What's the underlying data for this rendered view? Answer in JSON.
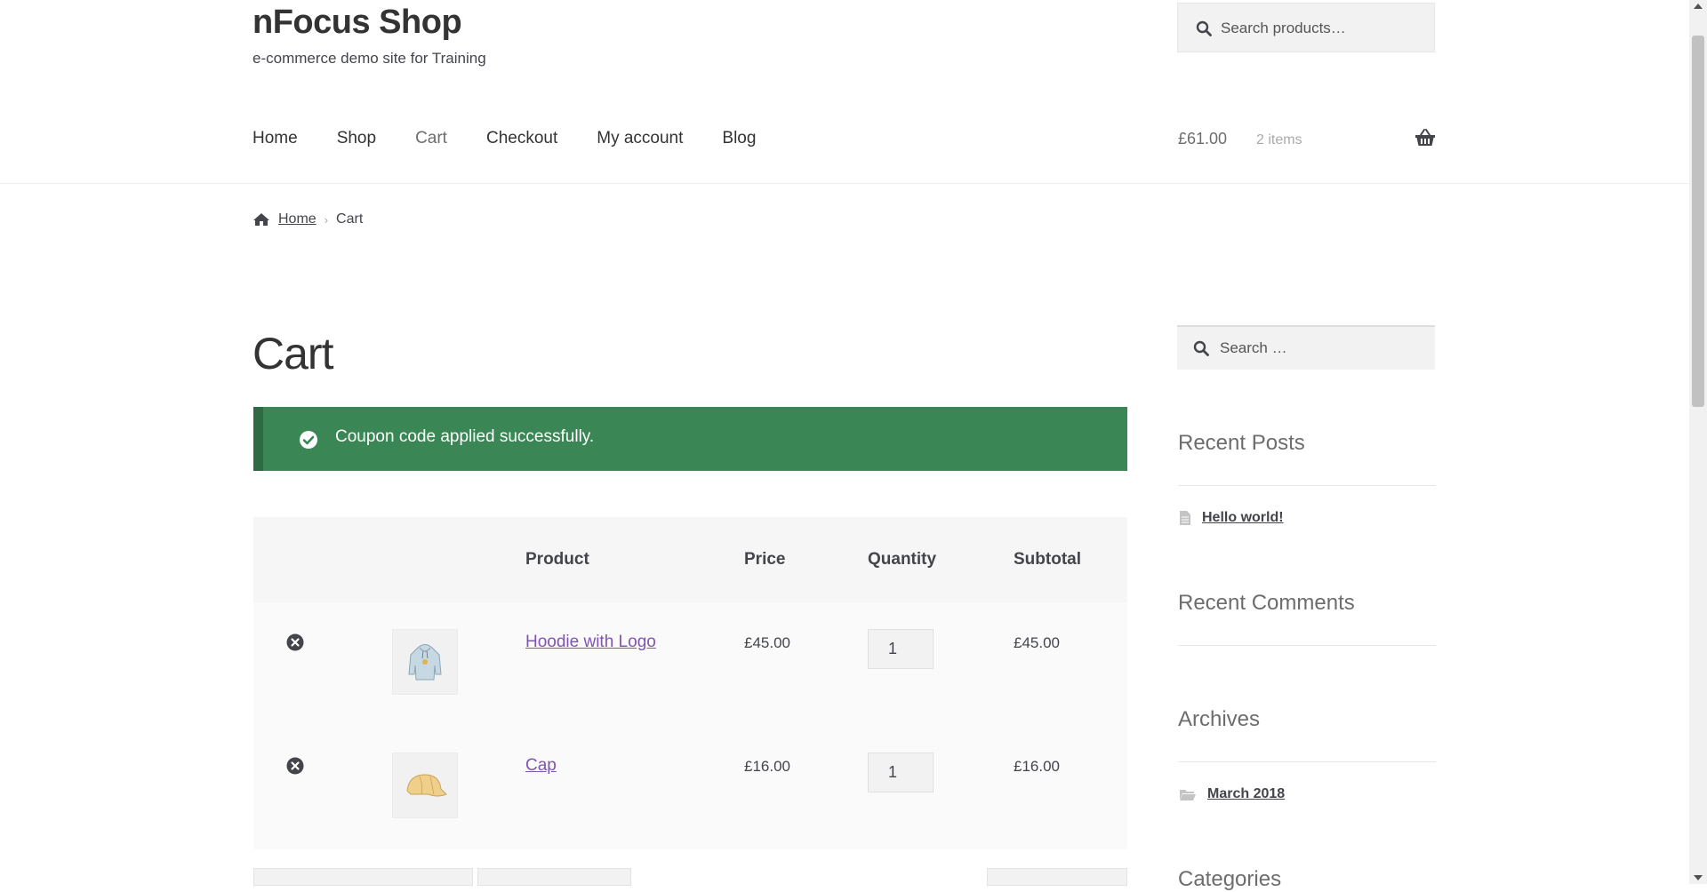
{
  "site": {
    "title": "nFocus Shop",
    "tagline": "e-commerce demo site for Training"
  },
  "header_search": {
    "placeholder": "Search products…"
  },
  "nav": {
    "items": [
      {
        "label": "Home"
      },
      {
        "label": "Shop"
      },
      {
        "label": "Cart",
        "current": true
      },
      {
        "label": "Checkout"
      },
      {
        "label": "My account"
      },
      {
        "label": "Blog"
      }
    ]
  },
  "mini_cart": {
    "amount": "£61.00",
    "count": "2 items",
    "icon": "basket-icon"
  },
  "breadcrumb": {
    "home": "Home",
    "current": "Cart",
    "icon": "home-icon"
  },
  "page_title": "Cart",
  "notice": {
    "message": "Coupon code applied successfully.",
    "color": "#3a8755",
    "icon": "check-circle-icon"
  },
  "cart_table": {
    "headers": {
      "product": "Product",
      "price": "Price",
      "quantity": "Quantity",
      "subtotal": "Subtotal"
    },
    "rows": [
      {
        "name": "Hoodie with Logo",
        "price": "£45.00",
        "quantity": "1",
        "subtotal": "£45.00",
        "thumb": "hoodie-thumbnail"
      },
      {
        "name": "Cap",
        "price": "£16.00",
        "quantity": "1",
        "subtotal": "£16.00",
        "thumb": "cap-thumbnail"
      }
    ]
  },
  "sidebar": {
    "search_placeholder": "Search …",
    "recent_posts": {
      "title": "Recent Posts",
      "items": [
        "Hello world!"
      ]
    },
    "recent_comments": {
      "title": "Recent Comments"
    },
    "archives": {
      "title": "Archives",
      "items": [
        "March 2018"
      ]
    },
    "categories": {
      "title": "Categories"
    }
  },
  "colors": {
    "link_purple": "#7f54b3",
    "notice_green": "#3a8755",
    "text": "#43454b"
  }
}
